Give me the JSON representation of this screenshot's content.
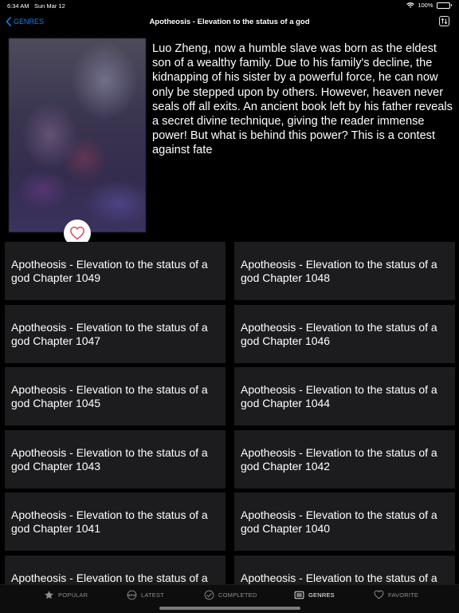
{
  "status_bar": {
    "time": "6:34 AM",
    "date": "Sun Mar 12",
    "battery": "100%"
  },
  "nav": {
    "back_label": "GENRES",
    "title": "Apotheosis - Elevation to the status of a god",
    "accent_color": "#0a84ff"
  },
  "novel": {
    "description": "Luo Zheng, now a humble slave was born as the eldest son of a wealthy family. Due to his family's decline, the kidnapping of his sister by a powerful force, he can now only be stepped upon by others. However, heaven never seals off all exits. An ancient book left by his father reveals a secret divine technique, giving the reader immense power! But what is behind this power? This is a contest against fate"
  },
  "chapters": [
    "Apotheosis - Elevation to the status of a god Chapter 1049",
    "Apotheosis - Elevation to the status of a god Chapter 1048",
    "Apotheosis - Elevation to the status of a god Chapter 1047",
    "Apotheosis - Elevation to the status of a god Chapter 1046",
    "Apotheosis - Elevation to the status of a god Chapter 1045",
    "Apotheosis - Elevation to the status of a god Chapter 1044",
    "Apotheosis - Elevation to the status of a god Chapter 1043",
    "Apotheosis - Elevation to the status of a god Chapter 1042",
    "Apotheosis - Elevation to the status of a god Chapter 1041",
    "Apotheosis - Elevation to the status of a god Chapter 1040",
    "Apotheosis - Elevation to the status of a",
    "Apotheosis - Elevation to the status of a"
  ],
  "tabs": [
    {
      "label": "POPULAR",
      "icon": "star-icon"
    },
    {
      "label": "LATEST",
      "icon": "new-badge-icon"
    },
    {
      "label": "COMPLETED",
      "icon": "checkmark-circle-icon"
    },
    {
      "label": "GENRES",
      "icon": "list-icon"
    },
    {
      "label": "FAVORITE",
      "icon": "heart-icon"
    }
  ],
  "active_tab": "GENRES"
}
